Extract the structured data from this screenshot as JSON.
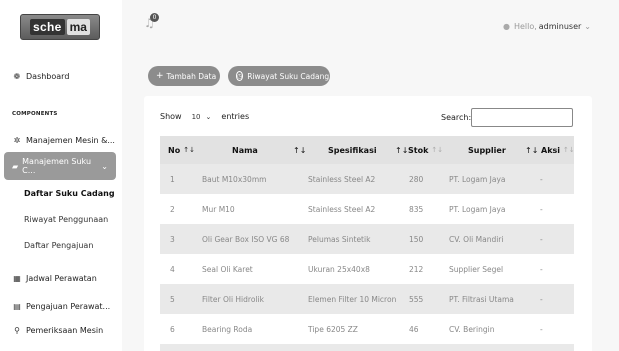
{
  "brand": {
    "part1": "sche",
    "part2": "ma"
  },
  "header": {
    "notification_count": "0",
    "user_greeting": "Hello,",
    "user_name": "adminuser"
  },
  "sidebar": {
    "dashboard": "Dashboard",
    "section_label": "COMPONENTS",
    "manajemen_mesin": "Manajemen Mesin &...",
    "manajemen_suku": "Manajemen Suku C...",
    "sub": {
      "daftar_suku": "Daftar Suku Cadang",
      "riwayat": "Riwayat Penggunaan",
      "pengajuan": "Daftar Pengajuan"
    },
    "jadwal": "Jadwal Perawatan",
    "pengajuan_perawatan": "Pengajuan Perawat...",
    "pemeriksaan": "Pemeriksaan Mesin"
  },
  "actions": {
    "add": "Tambah Data",
    "history": "Riwayat Suku Cadang"
  },
  "table_controls": {
    "show_label": "Show",
    "show_value": "10",
    "entries_label": "entries",
    "search_label": "Search:"
  },
  "table": {
    "columns": [
      "No",
      "Nama",
      "Spesifikasi",
      "Stok",
      "Supplier",
      "Aksi"
    ],
    "rows": [
      [
        "1",
        "Baut M10x30mm",
        "Stainless Steel A2",
        "280",
        "PT. Logam Jaya",
        "-"
      ],
      [
        "2",
        "Mur M10",
        "Stainless Steel A2",
        "835",
        "PT. Logam Jaya",
        "-"
      ],
      [
        "3",
        "Oli Gear Box ISO VG 68",
        "Pelumas Sintetik",
        "150",
        "CV. Oli Mandiri",
        "-"
      ],
      [
        "4",
        "Seal Oli Karet",
        "Ukuran 25x40x8",
        "212",
        "Supplier Segel",
        "-"
      ],
      [
        "5",
        "Filter Oli Hidrolik",
        "Elemen Filter 10 Micron",
        "555",
        "PT. Filtrasi Utama",
        "-"
      ],
      [
        "6",
        "Bearing Roda",
        "Tipe 6205 ZZ",
        "46",
        "CV. Beringin",
        "-"
      ]
    ]
  }
}
